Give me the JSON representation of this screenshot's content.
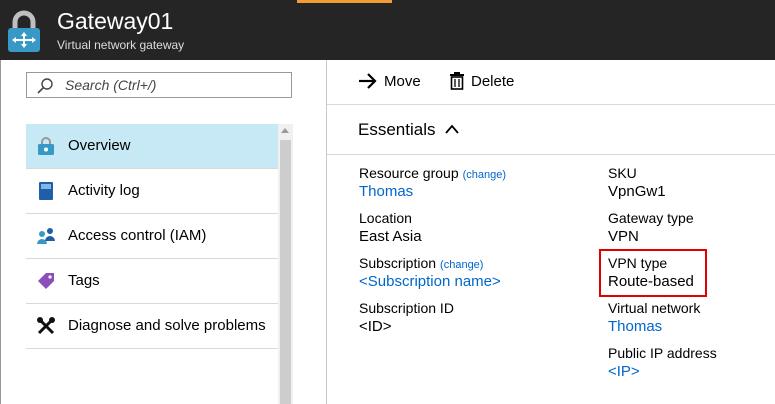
{
  "header": {
    "title": "Gateway01",
    "subtitle": "Virtual network gateway",
    "logo_icon": "vpn-gateway-lock-icon"
  },
  "search": {
    "placeholder": "Search (Ctrl+/)",
    "icon": "search-icon"
  },
  "menu": {
    "items": [
      {
        "label": "Overview",
        "icon": "overview-lock-icon",
        "active": true
      },
      {
        "label": "Activity log",
        "icon": "activity-log-icon",
        "active": false
      },
      {
        "label": "Access control (IAM)",
        "icon": "people-icon",
        "active": false
      },
      {
        "label": "Tags",
        "icon": "tag-icon",
        "active": false
      },
      {
        "label": "Diagnose and solve problems",
        "icon": "wrench-icon",
        "active": false
      }
    ]
  },
  "toolbar": {
    "move_label": "Move",
    "delete_label": "Delete"
  },
  "essentials": {
    "title": "Essentials",
    "change_label": "(change)",
    "left": {
      "resource_group_label": "Resource group",
      "resource_group_value": "Thomas",
      "location_label": "Location",
      "location_value": "East Asia",
      "subscription_label": "Subscription",
      "subscription_value": "<Subscription name>",
      "subscription_id_label": "Subscription ID",
      "subscription_id_value": "<ID>"
    },
    "right": {
      "sku_label": "SKU",
      "sku_value": "VpnGw1",
      "gateway_type_label": "Gateway type",
      "gateway_type_value": "VPN",
      "vpn_type_label": "VPN type",
      "vpn_type_value": "Route-based",
      "virtual_network_label": "Virtual network",
      "virtual_network_value": "Thomas",
      "public_ip_label": "Public IP address",
      "public_ip_value": "<IP>"
    }
  },
  "colors": {
    "header_bg": "#252525",
    "accent": "#f39c33",
    "active_item_bg": "#c7e8f5",
    "link": "#0066cc",
    "highlight_border": "#e00000"
  }
}
